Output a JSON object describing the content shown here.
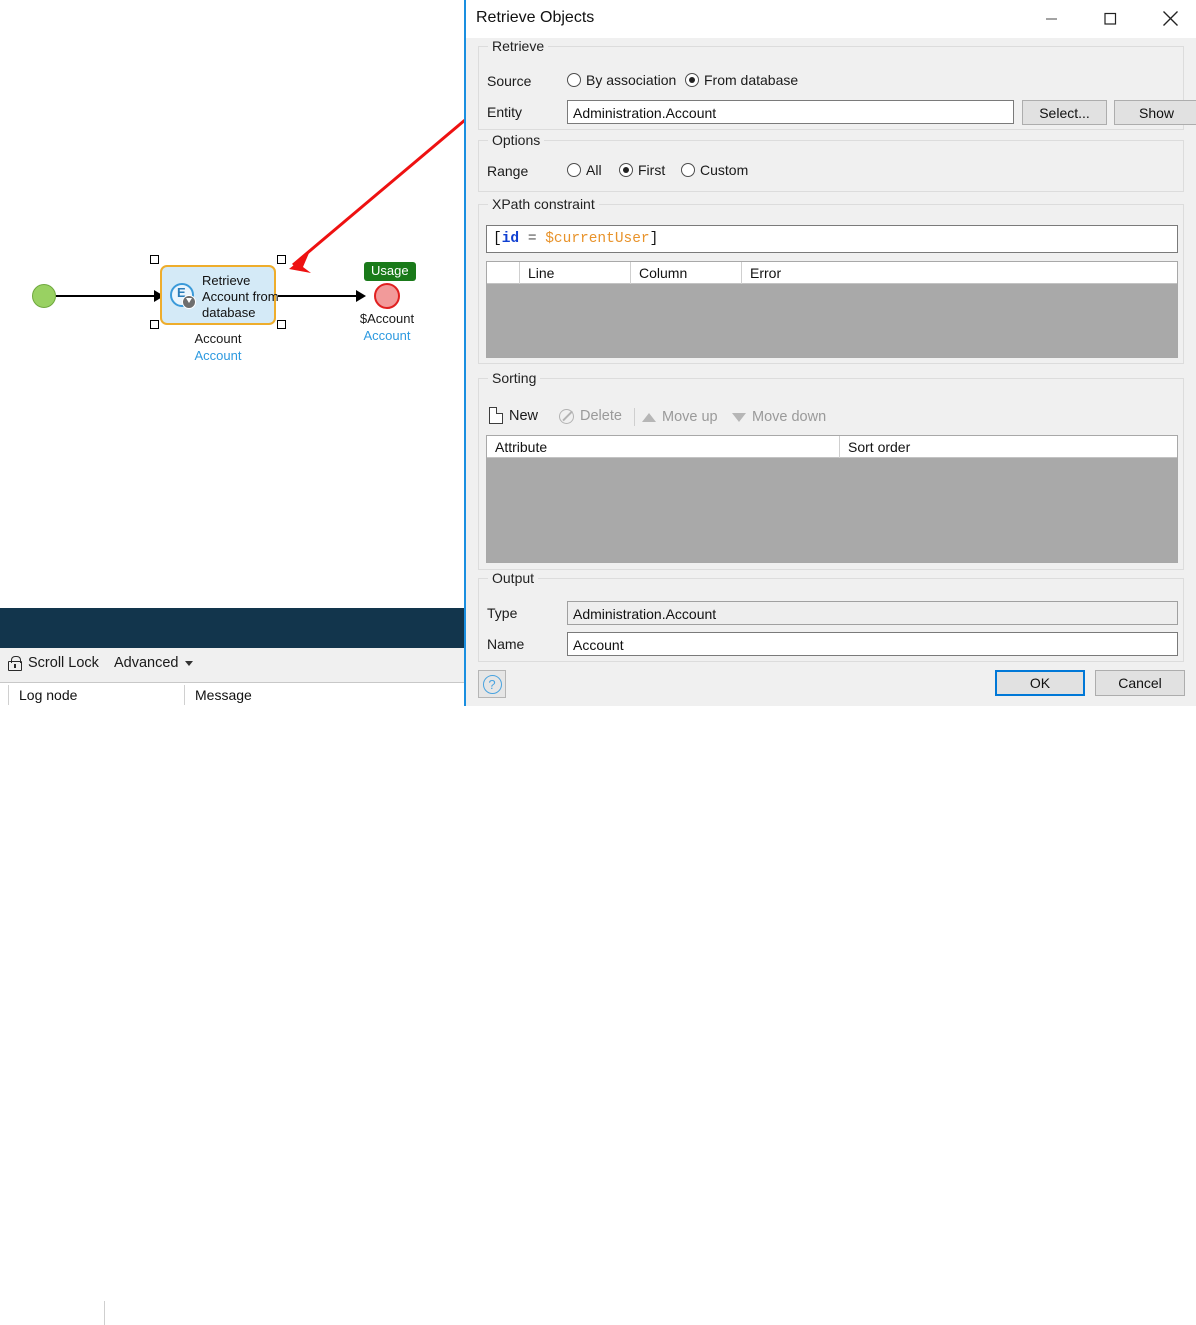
{
  "background_app": {
    "diagram": {
      "start_node_name": "start-event",
      "activity_label": "Retrieve Account from database",
      "activity_caption_name": "Account",
      "activity_caption_type": "Account",
      "end_variable_name": "$Account",
      "end_variable_type": "Account",
      "usage_badge": "Usage"
    },
    "toolbar": {
      "scroll_lock": "Scroll Lock",
      "advanced": "Advanced"
    },
    "log_grid": {
      "columns": [
        "Log node",
        "Message"
      ]
    }
  },
  "dialog": {
    "title": "Retrieve Objects",
    "window_buttons": {
      "minimize": "minimize-button",
      "maximize": "maximize-button",
      "close": "close-button"
    },
    "retrieve_group": {
      "title": "Retrieve",
      "source_label": "Source",
      "source_options": [
        "By association",
        "From database"
      ],
      "source_selected": "From database",
      "entity_label": "Entity",
      "entity_value": "Administration.Account",
      "select_button": "Select...",
      "show_button": "Show"
    },
    "options_group": {
      "title": "Options",
      "range_label": "Range",
      "range_options": [
        "All",
        "First",
        "Custom"
      ],
      "range_selected": "First"
    },
    "xpath_group": {
      "title": "XPath constraint",
      "expression": {
        "open_bracket": "[",
        "attribute": "id",
        "operator": "=",
        "variable": "$currentUser",
        "close_bracket": "]"
      },
      "expression_plain": "[id = $currentUser]",
      "error_grid": {
        "columns": [
          "",
          "Line",
          "Column",
          "Error"
        ],
        "rows": []
      }
    },
    "sorting_group": {
      "title": "Sorting",
      "actions": [
        {
          "label": "New",
          "icon": "new-page-icon",
          "enabled": true
        },
        {
          "label": "Delete",
          "icon": "delete-circle-icon",
          "enabled": false
        },
        {
          "label": "Move up",
          "icon": "triangle-up-icon",
          "enabled": false
        },
        {
          "label": "Move down",
          "icon": "triangle-down-icon",
          "enabled": false
        }
      ],
      "grid": {
        "columns": [
          "Attribute",
          "Sort order"
        ],
        "rows": []
      }
    },
    "output_group": {
      "title": "Output",
      "type_label": "Type",
      "type_value": "Administration.Account",
      "name_label": "Name",
      "name_value": "Account"
    },
    "footer": {
      "help_button": "?",
      "ok_button": "OK",
      "cancel_button": "Cancel"
    },
    "colors": {
      "accent": "#1a8fe0",
      "focus": "#0078d7",
      "dialog_bg": "#f0f0f0",
      "grid_disabled": "#a9a9a9",
      "xpath_attribute": "#0f3fd1",
      "xpath_variable": "#e8932b"
    }
  }
}
